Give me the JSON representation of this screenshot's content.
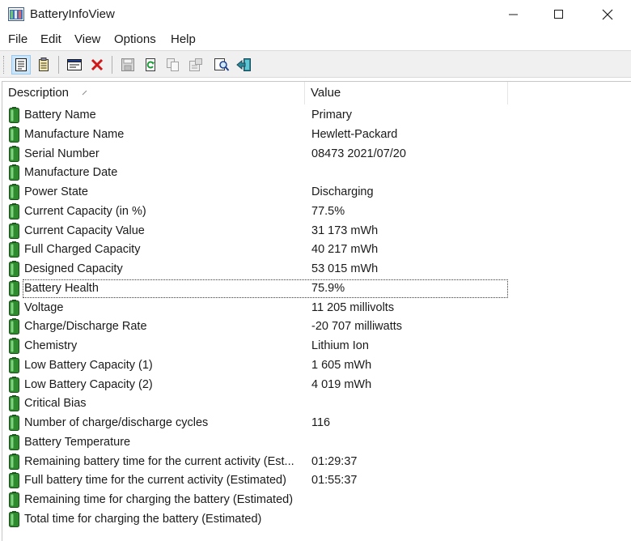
{
  "window": {
    "title": "BatteryInfoView"
  },
  "menu": {
    "file": "File",
    "edit": "Edit",
    "view": "View",
    "options": "Options",
    "help": "Help"
  },
  "toolbar": {
    "icons": [
      "properties-icon",
      "html-report-icon",
      "advanced-options-icon",
      "delete-icon",
      "save-icon",
      "refresh-icon",
      "copy-icon",
      "options-icon",
      "find-icon",
      "exit-icon"
    ]
  },
  "columns": {
    "description": "Description",
    "value": "Value"
  },
  "rows": [
    {
      "description": "Battery Name",
      "value": "Primary"
    },
    {
      "description": "Manufacture Name",
      "value": "Hewlett-Packard"
    },
    {
      "description": "Serial Number",
      "value": "08473 2021/07/20"
    },
    {
      "description": "Manufacture Date",
      "value": ""
    },
    {
      "description": "Power State",
      "value": "Discharging"
    },
    {
      "description": "Current Capacity (in %)",
      "value": "77.5%"
    },
    {
      "description": "Current Capacity Value",
      "value": "31 173 mWh"
    },
    {
      "description": "Full Charged Capacity",
      "value": "40 217 mWh"
    },
    {
      "description": "Designed Capacity",
      "value": "53 015 mWh"
    },
    {
      "description": "Battery Health",
      "value": "75.9%"
    },
    {
      "description": "Voltage",
      "value": "11 205 millivolts"
    },
    {
      "description": "Charge/Discharge Rate",
      "value": "-20 707 milliwatts"
    },
    {
      "description": "Chemistry",
      "value": "Lithium Ion"
    },
    {
      "description": "Low Battery Capacity (1)",
      "value": "1 605 mWh"
    },
    {
      "description": "Low Battery Capacity (2)",
      "value": "4 019 mWh"
    },
    {
      "description": "Critical Bias",
      "value": ""
    },
    {
      "description": "Number of charge/discharge cycles",
      "value": "116"
    },
    {
      "description": "Battery Temperature",
      "value": ""
    },
    {
      "description": "Remaining battery time for the current activity (Est...",
      "value": "01:29:37"
    },
    {
      "description": "Full battery time for the current activity (Estimated)",
      "value": "01:55:37"
    },
    {
      "description": "Remaining time for charging the battery (Estimated)",
      "value": ""
    },
    {
      "description": "Total  time for charging the battery (Estimated)",
      "value": ""
    }
  ],
  "selected_row_index": 9,
  "colors": {
    "battery": "#2e8b2e",
    "selection_focus": "#3a3a3a"
  }
}
